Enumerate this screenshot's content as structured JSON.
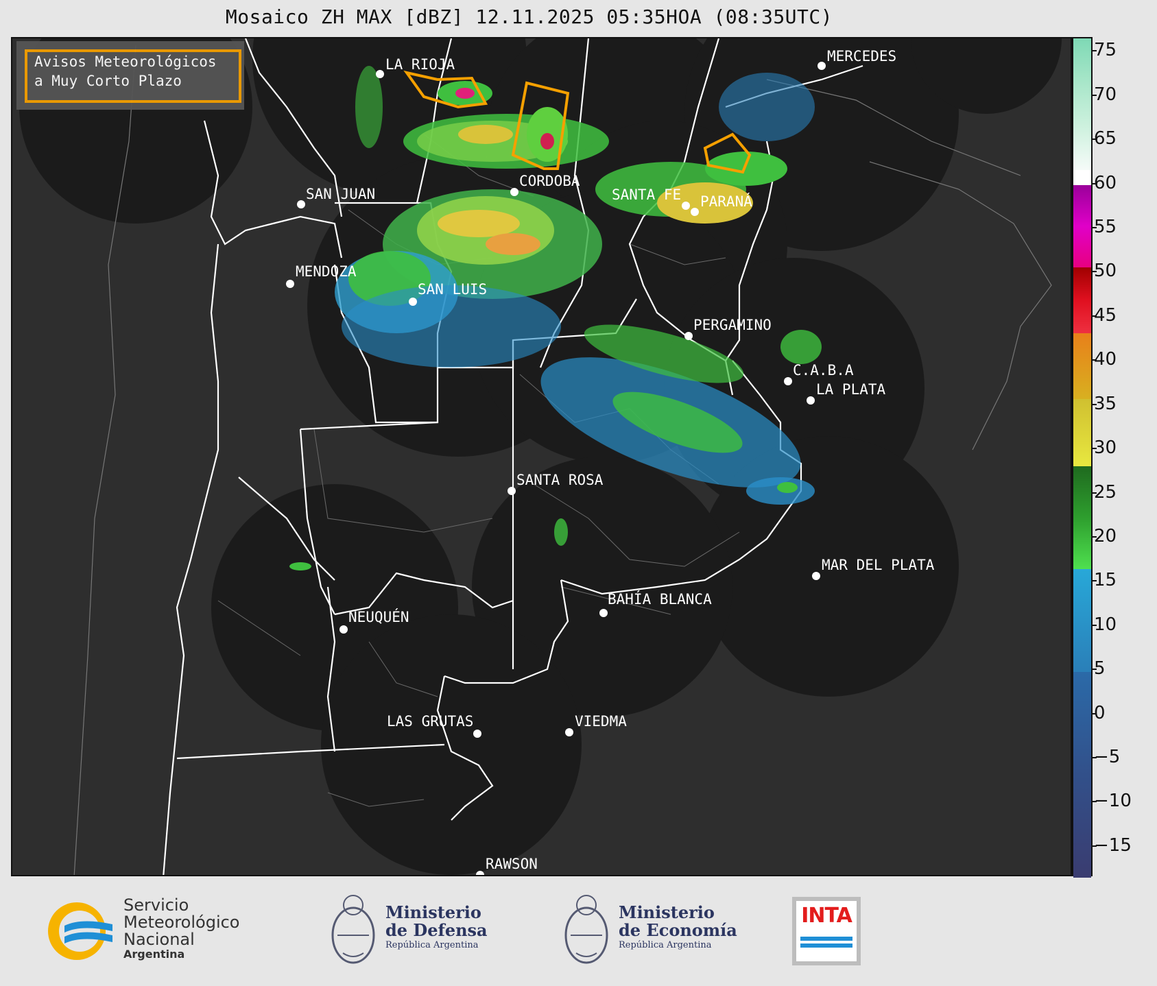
{
  "title": "Mosaico ZH MAX [dBZ] 12.11.2025 05:35HOA (08:35UTC)",
  "warning_legend": {
    "line1": "Avisos Meteorológicos",
    "line2": "a Muy Corto Plazo",
    "color": "#f5a000"
  },
  "cities": [
    {
      "name": "LA RIOJA"
    },
    {
      "name": "MERCEDES"
    },
    {
      "name": "SAN JUAN"
    },
    {
      "name": "CORDOBA"
    },
    {
      "name": "SANTA FE"
    },
    {
      "name": "PARANÁ"
    },
    {
      "name": "MENDOZA"
    },
    {
      "name": "SAN LUIS"
    },
    {
      "name": "PERGAMINO"
    },
    {
      "name": "C.A.B.A"
    },
    {
      "name": "LA PLATA"
    },
    {
      "name": "SANTA ROSA"
    },
    {
      "name": "MAR DEL PLATA"
    },
    {
      "name": "BAHÍA BLANCA"
    },
    {
      "name": "NEUQUÉN"
    },
    {
      "name": "LAS GRUTAS"
    },
    {
      "name": "VIEDMA"
    },
    {
      "name": "RAWSON"
    }
  ],
  "colorbar": {
    "unit": "dBZ",
    "min": -18.5,
    "max": 76.5,
    "ticks": [
      "75",
      "70",
      "65",
      "60",
      "55",
      "50",
      "45",
      "40",
      "35",
      "30",
      "25",
      "20",
      "15",
      "10",
      "5",
      "0",
      "−5",
      "−10",
      "−15"
    ]
  },
  "footer": {
    "smn_line1": "Servicio",
    "smn_line2": "Meteorológico",
    "smn_line3": "Nacional",
    "smn_line4": "Argentina",
    "defensa_line1": "Ministerio",
    "defensa_line2": "de Defensa",
    "defensa_line3": "República Argentina",
    "economia_line1": "Ministerio",
    "economia_line2": "de Economía",
    "economia_line3": "República Argentina",
    "inta_label": "INTA"
  }
}
